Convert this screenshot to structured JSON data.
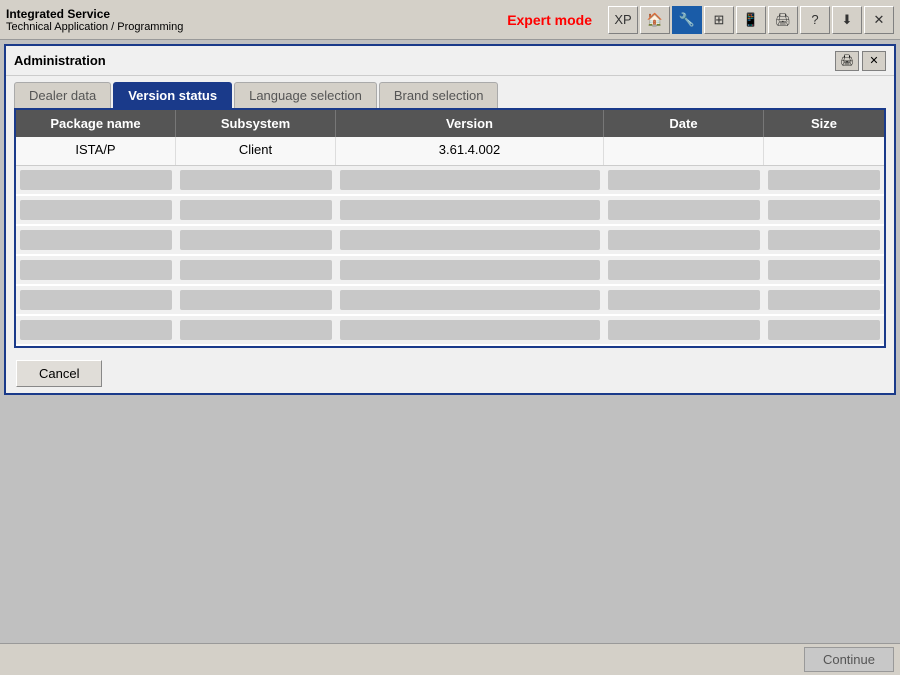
{
  "titlebar": {
    "line1": "Integrated Service",
    "line2": "Technical Application / Programming",
    "expert_mode": "Expert mode"
  },
  "toolbar": {
    "buttons": [
      "XP",
      "🏠",
      "🔧",
      "⊞",
      "📱",
      "🖨",
      "?",
      "⬇",
      "✕"
    ]
  },
  "window": {
    "title": "Administration",
    "tabs": [
      {
        "id": "dealer-data",
        "label": "Dealer data",
        "active": false
      },
      {
        "id": "version-status",
        "label": "Version status",
        "active": true
      },
      {
        "id": "language-selection",
        "label": "Language selection",
        "active": false
      },
      {
        "id": "brand-selection",
        "label": "Brand selection",
        "active": false
      }
    ],
    "table": {
      "columns": [
        "Package name",
        "Subsystem",
        "Version",
        "Date",
        "Size"
      ],
      "rows": [
        {
          "package_name": "ISTA/P",
          "subsystem": "Client",
          "version": "3.61.4.002",
          "date": "",
          "size": ""
        }
      ],
      "empty_row_count": 6
    },
    "cancel_button": "Cancel",
    "continue_button": "Continue"
  }
}
